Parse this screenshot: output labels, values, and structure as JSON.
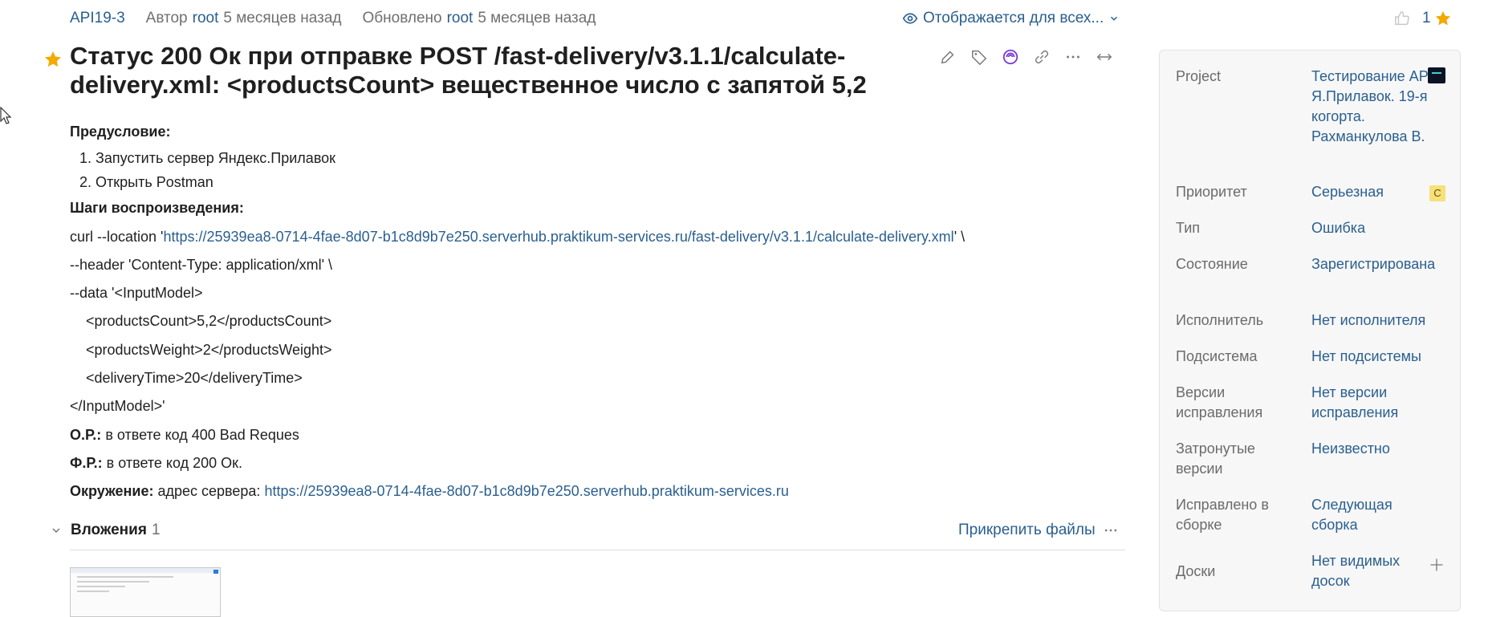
{
  "meta": {
    "issue_id": "API19-3",
    "author_label": "Автор",
    "author": "root",
    "created_ago": "5 месяцев назад",
    "updated_label": "Обновлено",
    "updater": "root",
    "updated_ago": "5 месяцев назад"
  },
  "visibility": {
    "label": "Отображается для всех...",
    "icon": "eye-icon"
  },
  "votes": {
    "count": "1",
    "icon": "thumbs-up-icon",
    "star_icon": "star-icon"
  },
  "title": "Статус 200 Ок при отправке POST /fast-delivery/v3.1.1/calculate-delivery.xml: <productsCount> вещественное число с запятой 5,2",
  "toolbar": {
    "icons": [
      "pencil-icon",
      "tag-icon",
      "ai-assistant-icon",
      "link-icon",
      "more-icon",
      "expand-icon"
    ]
  },
  "description": {
    "precondition_label": "Предусловие:",
    "precondition_items": [
      "1. Запустить сервер Яндекс.Прилавок",
      "2. Открыть Postman"
    ],
    "steps_label": "Шаги воспроизведения:",
    "curl_prefix": "curl --location '",
    "curl_url": "https://25939ea8-0714-4fae-8d07-b1c8d9b7e250.serverhub.praktikum-services.ru/fast-delivery/v3.1.1/calculate-delivery.xml",
    "curl_suffix": "' \\",
    "header_line": "--header 'Content-Type: application/xml' \\",
    "data_line": "--data '<InputModel>",
    "xml_lines": [
      "<productsCount>5,2</productsCount>",
      "<productsWeight>2</productsWeight>",
      "<deliveryTime>20</deliveryTime>"
    ],
    "close_line": "</InputModel>'",
    "expected_label": "О.Р.:",
    "expected": " в ответе код 400 Bad Reques",
    "actual_label": "Ф.Р.:",
    "actual": " в ответе код 200 Ок.",
    "env_label": "Окружение:",
    "env_text": " адрес сервера: ",
    "env_url": "https://25939ea8-0714-4fae-8d07-b1c8d9b7e250.serverhub.praktikum-services.ru"
  },
  "attachments": {
    "title": "Вложения",
    "count": "1",
    "attach_button": "Прикрепить файлы"
  },
  "fields": [
    {
      "label": "Project",
      "value": "Тестирование API Я.Прилавок. 19-я когорта. Рахманкулова В."
    },
    {
      "label": "Приоритет",
      "value": "Серьезная",
      "badge": "С"
    },
    {
      "label": "Тип",
      "value": "Ошибка"
    },
    {
      "label": "Состояние",
      "value": "Зарегистрирована"
    },
    {
      "label": "Исполнитель",
      "value": "Нет исполнителя"
    },
    {
      "label": "Подсистема",
      "value": "Нет подсистемы"
    },
    {
      "label": "Версии исправления",
      "value": "Нет версии исправления"
    },
    {
      "label": "Затронутые версии",
      "value": "Неизвестно"
    },
    {
      "label": "Исправлено в сборке",
      "value": "Следующая сборка"
    },
    {
      "label": "Доски",
      "value": "Нет видимых досок"
    }
  ],
  "colors": {
    "link": "#2a5f8f",
    "star": "#f2a900",
    "ai": "#7a3ed8",
    "badge": "#f6e07a"
  }
}
